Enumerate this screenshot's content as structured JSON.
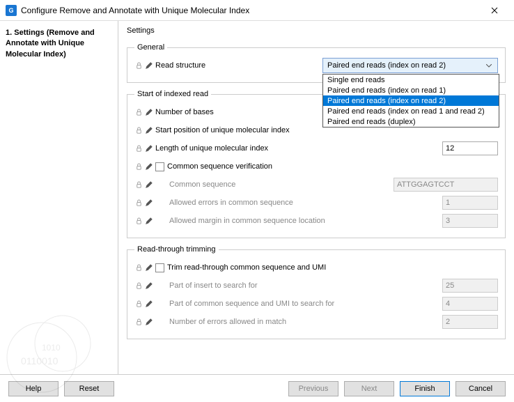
{
  "window": {
    "title": "Configure Remove and Annotate with Unique Molecular Index",
    "appicon_text": "G"
  },
  "sidebar": {
    "step_number": "1.",
    "step_title": "Settings (Remove and Annotate with Unique Molecular Index)"
  },
  "content": {
    "heading": "Settings",
    "general": {
      "legend": "General",
      "read_structure_label": "Read structure",
      "read_structure_value": "Paired end reads (index on read 2)",
      "read_structure_options": [
        "Single end reads",
        "Paired end reads (index on read 1)",
        "Paired end reads (index on read 2)",
        "Paired end reads (index on read 1 and read 2)",
        "Paired end reads (duplex)"
      ],
      "selected_index": 2
    },
    "indexed": {
      "legend": "Start of indexed read",
      "num_bases_label": "Number of bases",
      "start_pos_label": "Start position of unique molecular index",
      "length_label": "Length of unique molecular index",
      "length_value": "12",
      "csv_label": "Common sequence verification",
      "common_seq_label": "Common sequence",
      "common_seq_value": "ATTGGAGTCCT",
      "allowed_errors_label": "Allowed errors in common sequence",
      "allowed_errors_value": "1",
      "allowed_margin_label": "Allowed margin in common sequence location",
      "allowed_margin_value": "3"
    },
    "readthrough": {
      "legend": "Read-through trimming",
      "trim_label": "Trim read-through common sequence and UMI",
      "part_insert_label": "Part of insert to search for",
      "part_insert_value": "25",
      "part_common_label": "Part of common sequence and UMI to search for",
      "part_common_value": "4",
      "num_errors_label": "Number of errors allowed in match",
      "num_errors_value": "2"
    }
  },
  "buttons": {
    "help": "Help",
    "reset": "Reset",
    "previous": "Previous",
    "next": "Next",
    "finish": "Finish",
    "cancel": "Cancel"
  }
}
